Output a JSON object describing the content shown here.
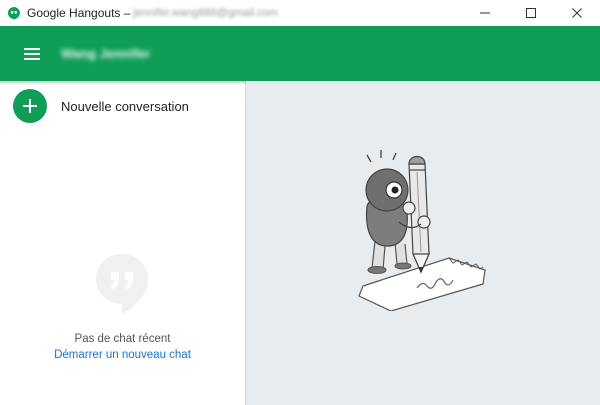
{
  "window": {
    "app_title": "Google Hangouts –",
    "account": "jennifer.wang888@gmail.com",
    "controls": [
      "minimize-icon",
      "maximize-icon",
      "close-icon"
    ]
  },
  "header": {
    "user_name": "Wang Jennifer",
    "menu_icon": "menu-icon",
    "color": "#0f9d58"
  },
  "sidebar": {
    "new_conversation_label": "Nouvelle conversation",
    "empty_state": {
      "icon": "hangouts-quote-icon",
      "text": "Pas de chat récent",
      "link": "Démarrer un nouveau chat"
    }
  },
  "main": {
    "illustration": "pencil-robot-illustration",
    "background": "#e9ecef"
  },
  "colors": {
    "brand_green": "#0f9d58",
    "link_blue": "#1a73c8"
  }
}
